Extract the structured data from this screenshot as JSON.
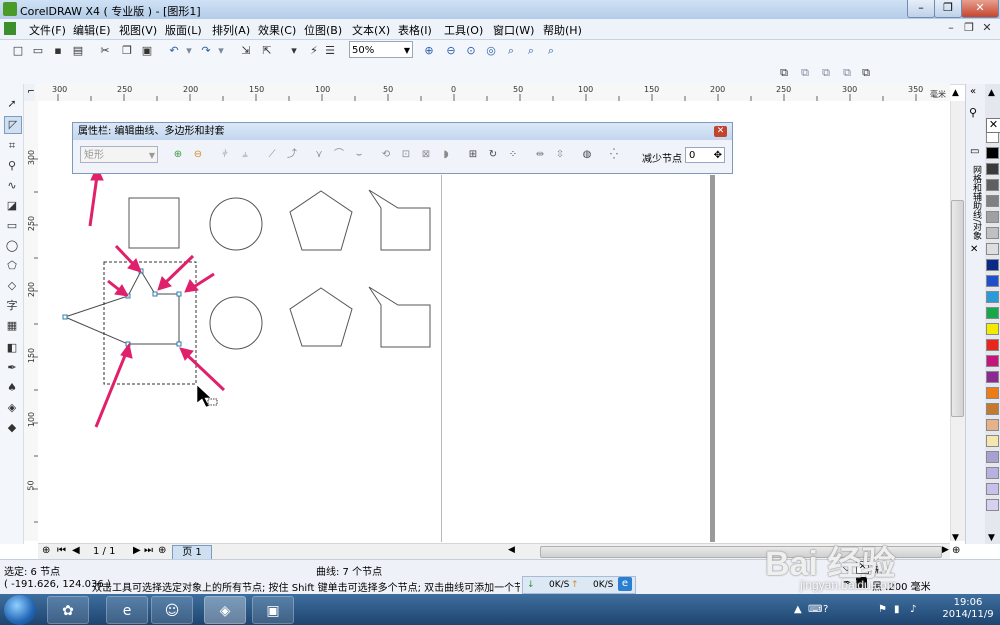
{
  "window": {
    "title": "CorelDRAW X4 ( 专业版 ) - [图形1]",
    "buttons": {
      "minimize": "–",
      "restore": "❐",
      "close": "✕"
    }
  },
  "menubar": {
    "items": [
      "文件(F)",
      "编辑(E)",
      "视图(V)",
      "版面(L)",
      "排列(A)",
      "效果(C)",
      "位图(B)",
      "文本(X)",
      "表格(I)",
      "工具(O)",
      "窗口(W)",
      "帮助(H)"
    ],
    "doc_controls": [
      "–",
      "❐",
      "✕"
    ]
  },
  "standard_toolbar": {
    "zoom": "50%"
  },
  "rulers": {
    "horizontal": [
      "300",
      "250",
      "200",
      "150",
      "100",
      "50",
      "0",
      "50",
      "100",
      "150",
      "200",
      "250",
      "300",
      "350"
    ],
    "horizontal_unit": "毫米",
    "vertical": [
      "300",
      "250",
      "200",
      "150",
      "100",
      "50"
    ]
  },
  "property_bar": {
    "title": "属性栏: 编辑曲线、多边形和封套",
    "close": "✕",
    "shape_select": "矩形",
    "reduce_nodes_label": "减少节点",
    "reduce_nodes_value": "0"
  },
  "page_nav": {
    "counter": "1 / 1",
    "page_tab": "页 1"
  },
  "docker": {
    "label": "网格和辅助线/对象"
  },
  "palette": {
    "colors": [
      "#ffffff",
      "#000000",
      "#3a3a3a",
      "#5f5f5f",
      "#808080",
      "#a0a0a0",
      "#c0c0c0",
      "#dedede",
      "#0b2a86",
      "#1f4fc9",
      "#2a9bd9",
      "#17a84a",
      "#f4ea00",
      "#e8261c",
      "#c6147d",
      "#8b2a90",
      "#ee7b14",
      "#c47a2c",
      "#e6b28a",
      "#f5e6b0",
      "#a8a0d0",
      "#b8b0e0",
      "#c8c0ea",
      "#d8d0f0"
    ]
  },
  "status": {
    "selection": "选定: 6 节点",
    "curve_info": "曲线: 7 个节点",
    "coords": "( -191.626, 124.036 )",
    "hint": "双击工具可选择选定对象上的所有节点; 按住 Shift 键单击可选择多个节点; 双击曲线可添加一个节点; 双",
    "net_down": "0K/S",
    "net_up": "0K/S",
    "fill_label": "无",
    "outline_label": "黑 .200 毫米"
  },
  "taskbar": {
    "time": "19:06",
    "date": "2014/11/9"
  },
  "watermark": {
    "logo": "Bai 经验",
    "url": "jingyan.baidu.com"
  }
}
